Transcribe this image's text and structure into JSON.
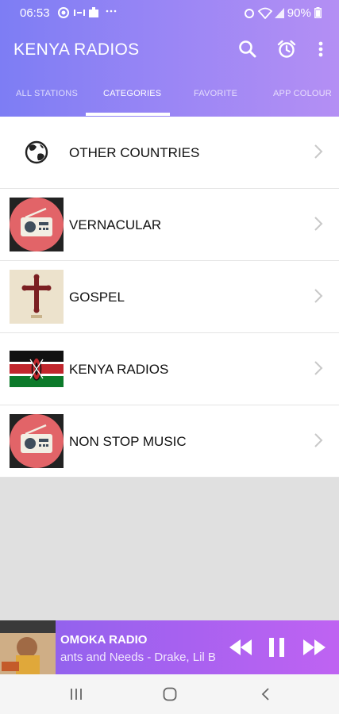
{
  "status_bar": {
    "time": "06:53",
    "battery": "90%"
  },
  "app_bar": {
    "title": "KENYA RADIOS"
  },
  "tabs": [
    {
      "label": "ALL STATIONS",
      "active": false
    },
    {
      "label": "CATEGORIES",
      "active": true
    },
    {
      "label": "FAVORITE",
      "active": false
    },
    {
      "label": "APP COLOUR",
      "active": false
    }
  ],
  "categories": [
    {
      "label": "OTHER COUNTRIES",
      "icon": "globe-icon"
    },
    {
      "label": "VERNACULAR",
      "icon": "radio-icon"
    },
    {
      "label": "GOSPEL",
      "icon": "cross-icon"
    },
    {
      "label": "KENYA RADIOS",
      "icon": "kenya-flag-icon"
    },
    {
      "label": "NON STOP MUSIC",
      "icon": "radio-icon"
    }
  ],
  "player": {
    "station": "OMOKA RADIO",
    "now_playing": "ants and Needs - Drake, Lil B"
  },
  "colors": {
    "header_start": "#7d7df4",
    "header_end": "#b48ff4",
    "player_start": "#8a63ec",
    "player_end": "#bf63f2"
  }
}
